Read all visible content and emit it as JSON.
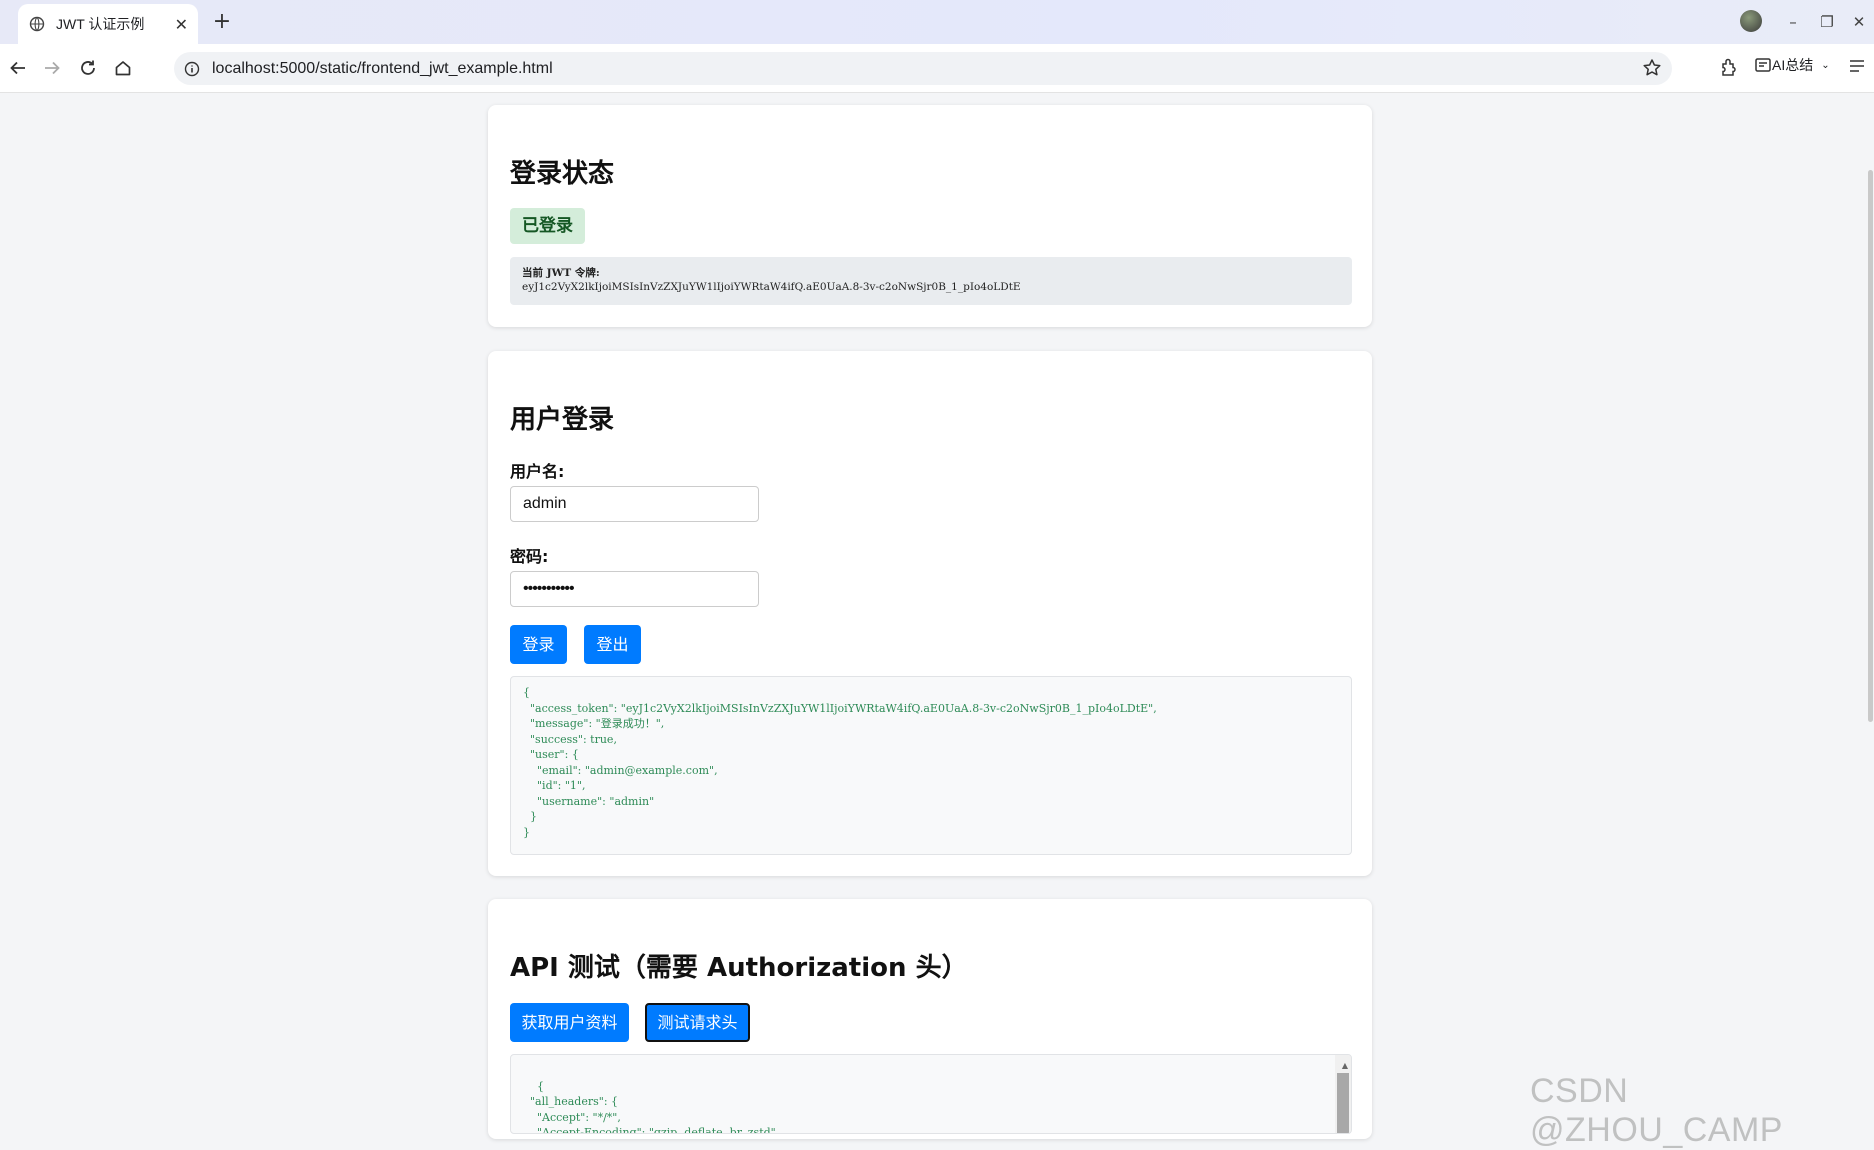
{
  "browser": {
    "tab_title": "JWT 认证示例",
    "new_tab": "+",
    "tab_close": "✕",
    "url": "localhost:5000/static/frontend_jwt_example.html",
    "ai_label": "AI总结",
    "win_minimize": "–",
    "win_restore": "❐",
    "win_close": "✕"
  },
  "login_status": {
    "title": "登录状态",
    "badge": "已登录",
    "token_label": "当前 JWT 令牌:",
    "token_value": "eyJ1c2VyX2lkIjoiMSIsInVzZXJuYW1lIjoiYWRtaW4ifQ.aE0UaA.8-3v-c2oNwSjr0B_1_pIo4oLDtE"
  },
  "user_login": {
    "title": "用户登录",
    "username_label": "用户名:",
    "username_value": "admin",
    "password_label": "密码:",
    "password_value": "•••••••••••",
    "login_button": "登录",
    "logout_button": "登出",
    "response": "{\n  \"access_token\": \"eyJ1c2VyX2lkIjoiMSIsInVzZXJuYW1lIjoiYWRtaW4ifQ.aE0UaA.8-3v-c2oNwSjr0B_1_pIo4oLDtE\",\n  \"message\": \"登录成功！\",\n  \"success\": true,\n  \"user\": {\n    \"email\": \"admin@example.com\",\n    \"id\": \"1\",\n    \"username\": \"admin\"\n  }\n}"
  },
  "api_test": {
    "title": "API 测试（需要 Authorization 头）",
    "profile_button": "获取用户资料",
    "headers_button": "测试请求头",
    "response": "{\n  \"all_headers\": {\n    \"Accept\": \"*/*\",\n    \"Accept-Encoding\": \"gzip, deflate, br, zstd\","
  },
  "watermark": "CSDN @ZHOU_CAMP",
  "colors": {
    "primary": "#007bff",
    "badge_bg": "#d4edda",
    "badge_text": "#155724",
    "code_text": "#2e8b57"
  }
}
